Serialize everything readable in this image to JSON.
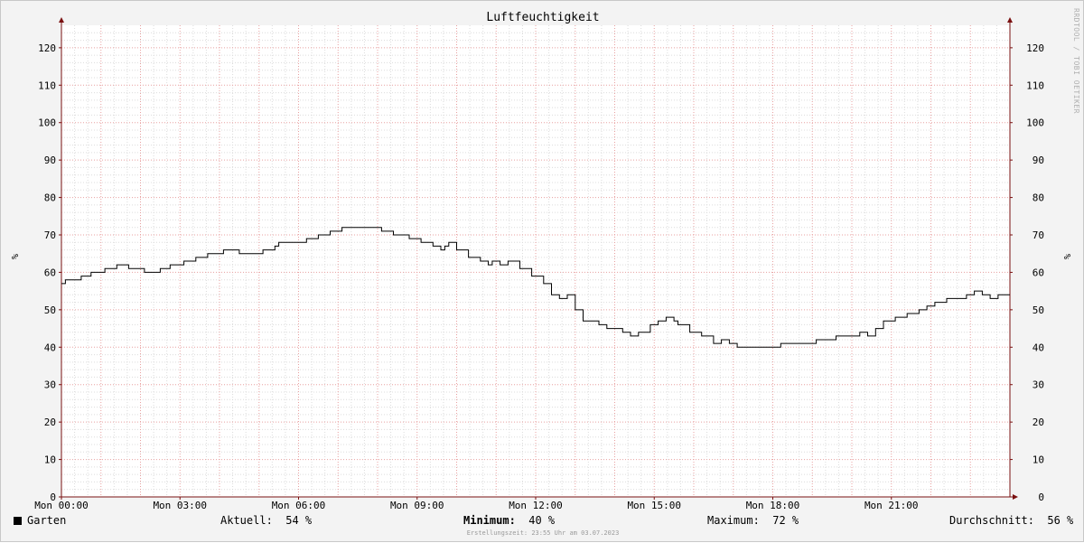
{
  "chart_data": {
    "type": "line",
    "title": "Luftfeuchtigkeit",
    "ylabel": "%",
    "ylim": [
      0,
      126
    ],
    "yticks": [
      0,
      10,
      20,
      30,
      40,
      50,
      60,
      70,
      80,
      90,
      100,
      110,
      120
    ],
    "xlim": [
      0,
      24
    ],
    "xticks": [
      {
        "x": 0,
        "label": "Mon 00:00"
      },
      {
        "x": 3,
        "label": "Mon 03:00"
      },
      {
        "x": 6,
        "label": "Mon 06:00"
      },
      {
        "x": 9,
        "label": "Mon 09:00"
      },
      {
        "x": 12,
        "label": "Mon 12:00"
      },
      {
        "x": 15,
        "label": "Mon 15:00"
      },
      {
        "x": 18,
        "label": "Mon 18:00"
      },
      {
        "x": 21,
        "label": "Mon 21:00"
      }
    ],
    "grid": true,
    "series": [
      {
        "name": "Garten",
        "color": "#000000",
        "x": [
          0,
          0.1,
          0.5,
          0.75,
          1.1,
          1.4,
          1.7,
          2.1,
          2.5,
          2.75,
          3.1,
          3.4,
          3.7,
          4.1,
          4.5,
          5.1,
          5.4,
          5.5,
          5.6,
          6.2,
          6.5,
          6.8,
          7.1,
          7.5,
          8.1,
          8.4,
          8.8,
          9.1,
          9.4,
          9.6,
          9.7,
          9.8,
          10.0,
          10.3,
          10.6,
          10.8,
          10.9,
          11.1,
          11.3,
          11.6,
          11.9,
          12.2,
          12.4,
          12.6,
          12.8,
          13.0,
          13.2,
          13.6,
          13.8,
          14.2,
          14.4,
          14.6,
          14.9,
          15.1,
          15.3,
          15.5,
          15.6,
          15.9,
          16.2,
          16.5,
          16.7,
          16.9,
          17.1,
          17.5,
          18.2,
          18.8,
          19.1,
          19.6,
          20.0,
          20.2,
          20.4,
          20.6,
          20.8,
          21.1,
          21.4,
          21.7,
          21.9,
          22.1,
          22.4,
          22.9,
          23.1,
          23.3,
          23.4,
          23.5,
          23.7,
          24.0
        ],
        "values": [
          57,
          58,
          59,
          60,
          61,
          62,
          61,
          60,
          61,
          62,
          63,
          64,
          65,
          66,
          65,
          66,
          67,
          68,
          68,
          69,
          70,
          71,
          72,
          72,
          71,
          70,
          69,
          68,
          67,
          66,
          67,
          68,
          66,
          64,
          63,
          62,
          63,
          62,
          63,
          61,
          59,
          57,
          54,
          53,
          54,
          50,
          47,
          46,
          45,
          44,
          43,
          44,
          46,
          47,
          48,
          47,
          46,
          44,
          43,
          41,
          42,
          41,
          40,
          40,
          41,
          41,
          42,
          43,
          43,
          44,
          43,
          45,
          47,
          48,
          49,
          50,
          51,
          52,
          53,
          54,
          55,
          54,
          54,
          53,
          54,
          54
        ]
      }
    ]
  },
  "legend": {
    "series_name": "Garten",
    "aktuell_label": "Aktuell:",
    "aktuell_value": "54 %",
    "minimum_label": "Minimum:",
    "minimum_value": "40 %",
    "maximum_label": "Maximum:",
    "maximum_value": "72 %",
    "durchschnitt_label": "Durchschnitt:",
    "durchschnitt_value": "56 %"
  },
  "footer": "Erstellungszeit: 23:55 Uhr am 03.07.2023",
  "watermark": "RRDTOOL / TOBI OETIKER",
  "colors": {
    "background": "#f3f3f3",
    "plot": "#ffffff",
    "minor_grid": "#dcdcdc",
    "major_grid": "#e8a0a0",
    "axis": "#7a1010",
    "line": "#000000"
  }
}
